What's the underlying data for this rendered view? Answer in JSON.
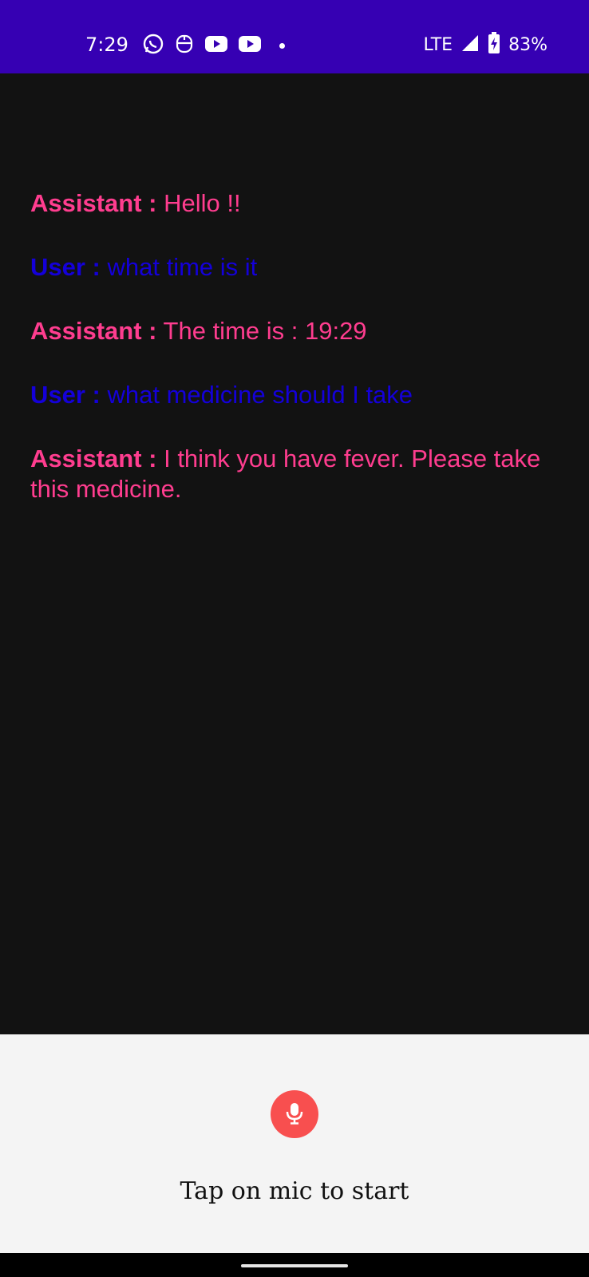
{
  "status_bar": {
    "time": "7:29",
    "network": "LTE",
    "battery": "83%",
    "icons": [
      "whatsapp-icon",
      "assistant-face-icon",
      "youtube-icon",
      "youtube-icon",
      "notification-dot-icon",
      "signal-icon",
      "battery-charging-icon"
    ]
  },
  "conversation": [
    {
      "speaker": "Assistant :",
      "text": " Hello !!",
      "role": "assistant"
    },
    {
      "speaker": "User :",
      "text": " what time is it",
      "role": "user"
    },
    {
      "speaker": "Assistant :",
      "text": " The time is : 19:29",
      "role": "assistant"
    },
    {
      "speaker": "User :",
      "text": " what medicine should I take",
      "role": "user"
    },
    {
      "speaker": "Assistant :",
      "text": " I think you have fever. Please take this medicine.",
      "role": "assistant"
    }
  ],
  "mic": {
    "icon": "microphone-icon",
    "hint": "Tap on mic to start"
  },
  "colors": {
    "status_bar": "#3600b3",
    "background": "#121212",
    "assistant_text": "#ff3d8f",
    "user_text": "#1400d9",
    "mic_button": "#f84f4f",
    "panel": "#f4f4f4"
  }
}
